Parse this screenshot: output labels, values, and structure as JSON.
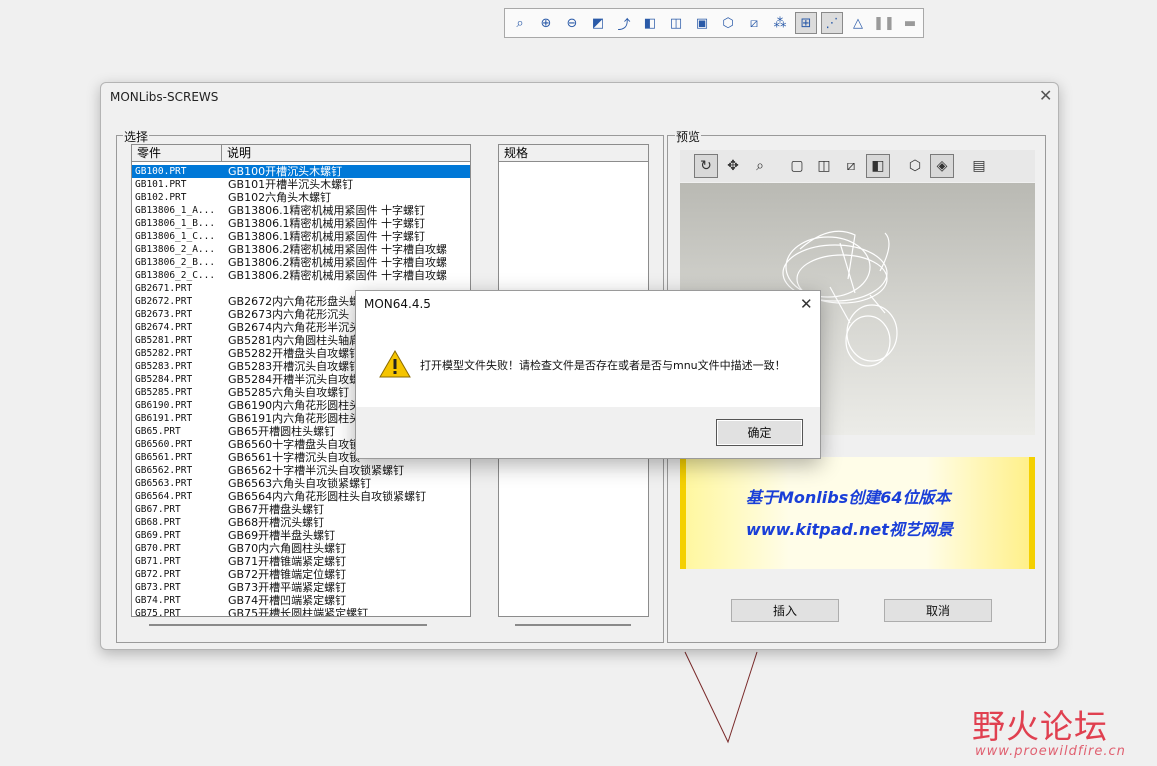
{
  "toolbar": {
    "icons": [
      "zoom-fit-icon",
      "zoom-in-icon",
      "zoom-out-icon",
      "repaint-icon",
      "orient-icon",
      "shaded-icon",
      "hidden-line-icon",
      "camera-icon",
      "view-manager-icon",
      "no-hidden-icon",
      "datum-planes-icon",
      "datum-axes-icon",
      "datum-points-icon",
      "csys-icon",
      "pause-icon",
      "stop-icon"
    ]
  },
  "window": {
    "title": "MONLibs-SCREWS",
    "select_group_label": "选择",
    "list_headers": {
      "part": "零件",
      "desc": "说明"
    },
    "spec_header": "规格",
    "preview_group_label": "预览",
    "insert_button": "插入",
    "cancel_button": "取消",
    "selected_index": 0
  },
  "parts": [
    {
      "part": "GB100.PRT",
      "desc": "GB100开槽沉头木螺钉"
    },
    {
      "part": "GB101.PRT",
      "desc": "GB101开槽半沉头木螺钉"
    },
    {
      "part": "GB102.PRT",
      "desc": "GB102六角头木螺钉"
    },
    {
      "part": "GB13806_1_A...",
      "desc": "GB13806.1精密机械用紧固件     十字螺钉"
    },
    {
      "part": "GB13806_1_B...",
      "desc": "GB13806.1精密机械用紧固件     十字螺钉"
    },
    {
      "part": "GB13806_1_C...",
      "desc": "GB13806.1精密机械用紧固件     十字螺钉"
    },
    {
      "part": "GB13806_2_A...",
      "desc": "GB13806.2精密机械用紧固件   十字槽自攻螺"
    },
    {
      "part": "GB13806_2_B...",
      "desc": "GB13806.2精密机械用紧固件   十字槽自攻螺"
    },
    {
      "part": "GB13806_2_C...",
      "desc": "GB13806.2精密机械用紧固件   十字槽自攻螺"
    },
    {
      "part": "GB2671.PRT",
      "desc": ""
    },
    {
      "part": "GB2672.PRT",
      "desc": "GB2672内六角花形盘头螺"
    },
    {
      "part": "GB2673.PRT",
      "desc": "GB2673内六角花形沉头"
    },
    {
      "part": "GB2674.PRT",
      "desc": "GB2674内六角花形半沉头"
    },
    {
      "part": "GB5281.PRT",
      "desc": "GB5281内六角圆柱头轴肩"
    },
    {
      "part": "GB5282.PRT",
      "desc": "GB5282开槽盘头自攻螺钉"
    },
    {
      "part": "GB5283.PRT",
      "desc": "GB5283开槽沉头自攻螺钉"
    },
    {
      "part": "GB5284.PRT",
      "desc": "GB5284开槽半沉头自攻螺"
    },
    {
      "part": "GB5285.PRT",
      "desc": "GB5285六角头自攻螺钉"
    },
    {
      "part": "GB6190.PRT",
      "desc": "GB6190内六角花形圆柱头"
    },
    {
      "part": "GB6191.PRT",
      "desc": "GB6191内六角花形圆柱头"
    },
    {
      "part": "GB65.PRT",
      "desc": "GB65开槽圆柱头螺钉"
    },
    {
      "part": "GB6560.PRT",
      "desc": "GB6560十字槽盘头自攻锁"
    },
    {
      "part": "GB6561.PRT",
      "desc": "GB6561十字槽沉头自攻锁"
    },
    {
      "part": "GB6562.PRT",
      "desc": "GB6562十字槽半沉头自攻锁紧螺钉"
    },
    {
      "part": "GB6563.PRT",
      "desc": "GB6563六角头自攻锁紧螺钉"
    },
    {
      "part": "GB6564.PRT",
      "desc": "GB6564内六角花形圆柱头自攻锁紧螺钉"
    },
    {
      "part": "GB67.PRT",
      "desc": "GB67开槽盘头螺钉"
    },
    {
      "part": "GB68.PRT",
      "desc": "GB68开槽沉头螺钉"
    },
    {
      "part": "GB69.PRT",
      "desc": "GB69开槽半盘头螺钉"
    },
    {
      "part": "GB70.PRT",
      "desc": "GB70内六角圆柱头螺钉"
    },
    {
      "part": "GB71.PRT",
      "desc": "GB71开槽锥端紧定螺钉"
    },
    {
      "part": "GB72.PRT",
      "desc": "GB72开槽锥端定位螺钉"
    },
    {
      "part": "GB73.PRT",
      "desc": "GB73开槽平端紧定螺钉"
    },
    {
      "part": "GB74.PRT",
      "desc": "GB74开槽凹端紧定螺钉"
    },
    {
      "part": "GB75.PRT",
      "desc": "GB75开槽长圆柱端紧定螺钉"
    }
  ],
  "preview_toolbar_icons": [
    "rotate-icon",
    "pan-icon",
    "zoom-window-icon",
    "wireframe-icon",
    "hidden-line-icon",
    "no-hidden-icon",
    "shaded-icon",
    "perspective-icon",
    "iso-view-icon",
    "film-icon"
  ],
  "banner": {
    "line1": "基于Monlibs创建64位版本",
    "line2": "www.kitpad.net视艺网景"
  },
  "dialog": {
    "title": "MON64.4.5",
    "message": "打开模型文件失败！请检查文件是否存在或者是否与mnu文件中描述一致！",
    "ok_button": "确定"
  },
  "watermark": {
    "brand": "野火论坛",
    "url": "www.proewildfire.cn"
  }
}
